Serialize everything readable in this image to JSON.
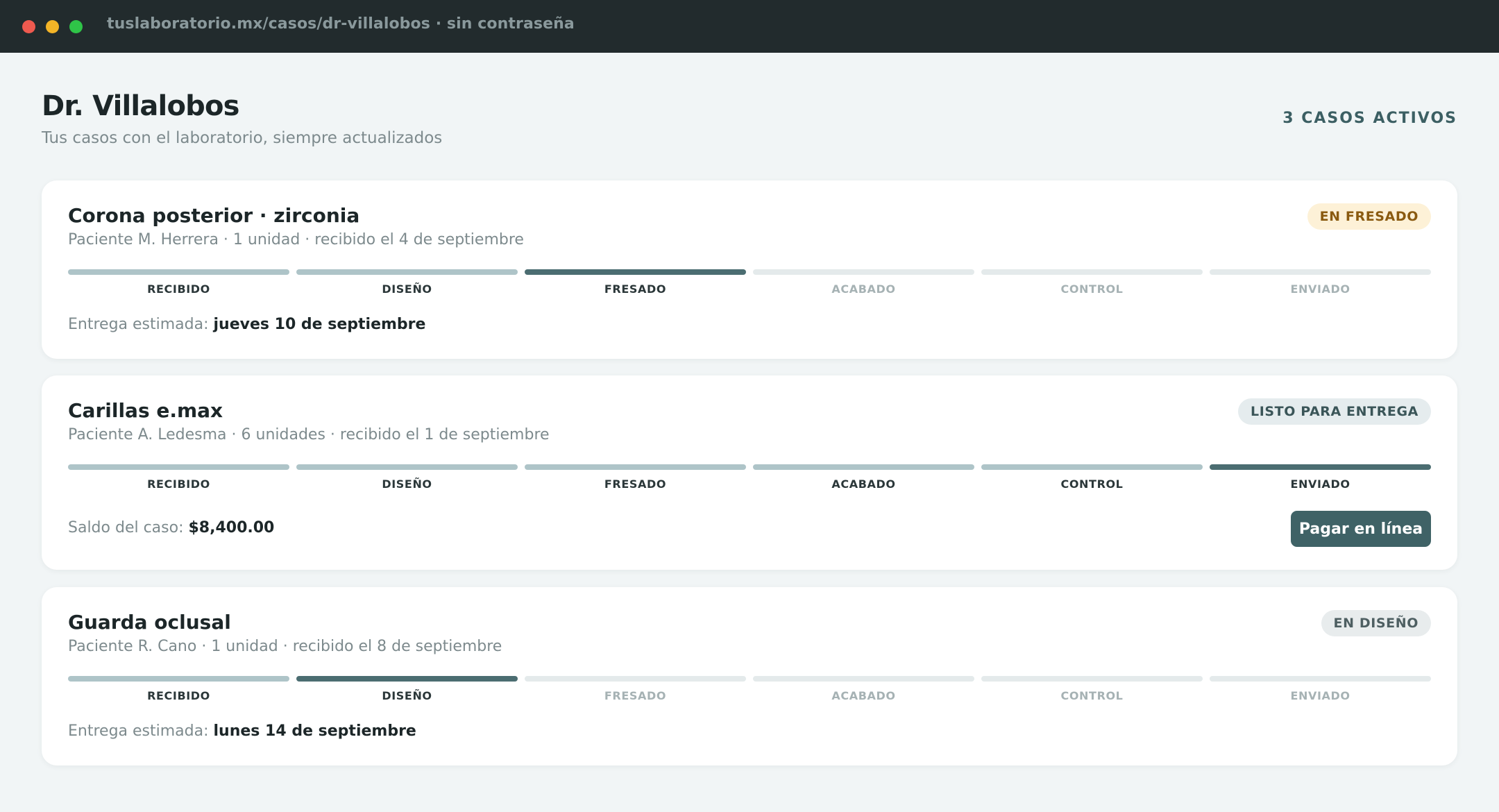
{
  "window": {
    "url": "tuslaboratorio.mx/casos/dr-villalobos · sin contraseña"
  },
  "header": {
    "title": "Dr. Villalobos",
    "subtitle": "Tus casos con el laboratorio, siempre actualizados",
    "active_cases": "3 CASOS ACTIVOS"
  },
  "stages": [
    "RECIBIDO",
    "DISEÑO",
    "FRESADO",
    "ACABADO",
    "CONTROL",
    "ENVIADO"
  ],
  "colors": {
    "step_done": "#aec4c8",
    "step_current": "#4b6d71",
    "step_pending": "#e4eaeb",
    "primary_button": "#3f6266"
  },
  "cases": [
    {
      "title": "Corona posterior · zirconia",
      "meta": "Paciente M. Herrera · 1 unidad · recibido el 4 de septiembre",
      "status": "EN FRESADO",
      "current_stage": 2,
      "footer_label": "Entrega estimada:",
      "footer_value": "jueves 10 de septiembre"
    },
    {
      "title": "Carillas e.max",
      "meta": "Paciente A. Ledesma · 6 unidades · recibido el 1 de septiembre",
      "status": "LISTO PARA ENTREGA",
      "current_stage": 5,
      "footer_label": "Saldo del caso:",
      "footer_value": "$8,400.00",
      "action_label": "Pagar en línea"
    },
    {
      "title": "Guarda oclusal",
      "meta": "Paciente R. Cano · 1 unidad · recibido el 8 de septiembre",
      "status": "EN DISEÑO",
      "current_stage": 1,
      "footer_label": "Entrega estimada:",
      "footer_value": "lunes 14 de septiembre"
    }
  ]
}
